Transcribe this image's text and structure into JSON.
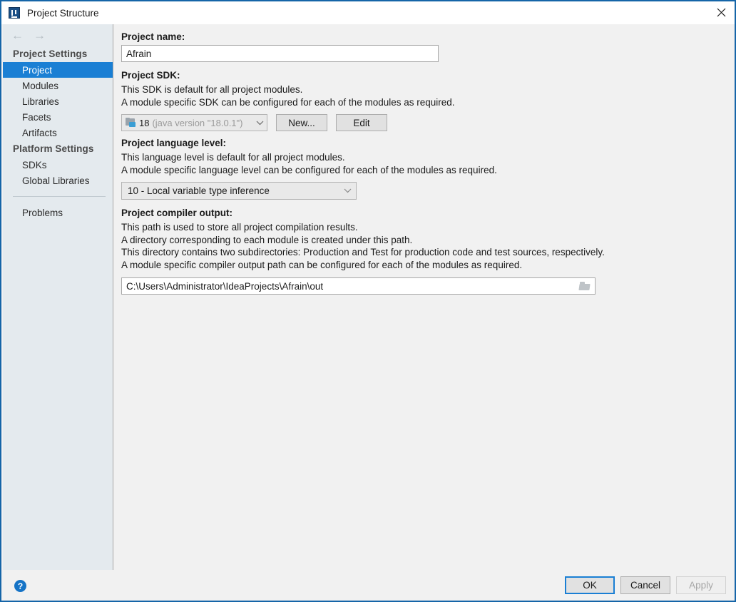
{
  "window": {
    "title": "Project Structure",
    "app_icon": "intellij-idea-icon",
    "close_icon": "close-icon",
    "accent_color": "#1a7fd4",
    "border_color": "#1565a8"
  },
  "sidebar": {
    "back_arrow": "←",
    "forward_arrow": "→",
    "groups": [
      {
        "header": "Project Settings",
        "items": [
          {
            "label": "Project",
            "selected": true
          },
          {
            "label": "Modules",
            "selected": false
          },
          {
            "label": "Libraries",
            "selected": false
          },
          {
            "label": "Facets",
            "selected": false
          },
          {
            "label": "Artifacts",
            "selected": false
          }
        ]
      },
      {
        "header": "Platform Settings",
        "items": [
          {
            "label": "SDKs",
            "selected": false
          },
          {
            "label": "Global Libraries",
            "selected": false
          }
        ]
      }
    ],
    "footer_items": [
      {
        "label": "Problems",
        "selected": false
      }
    ]
  },
  "main": {
    "project_name": {
      "label": "Project name:",
      "value": "Afrain",
      "placeholder": ""
    },
    "project_sdk": {
      "label": "Project SDK:",
      "descriptions": [
        "This SDK is default for all project modules.",
        "A module specific SDK can be configured for each of the modules as required."
      ],
      "selected_name": "18",
      "selected_version": "(java version \"18.0.1\")",
      "icon": "jdk-folder-icon",
      "dropdown_icon": "chevron-down-icon",
      "new_button": "New...",
      "edit_button": "Edit"
    },
    "language_level": {
      "label": "Project language level:",
      "descriptions": [
        "This language level is default for all project modules.",
        "A module specific language level can be configured for each of the modules as required."
      ],
      "selected": "10 - Local variable type inference",
      "dropdown_icon": "chevron-down-icon"
    },
    "compiler_output": {
      "label": "Project compiler output:",
      "descriptions": [
        "This path is used to store all project compilation results.",
        "A directory corresponding to each module is created under this path.",
        "This directory contains two subdirectories: Production and Test for production code and test sources, respectively.",
        "A module specific compiler output path can be configured for each of the modules as required."
      ],
      "value": "C:\\Users\\Administrator\\IdeaProjects\\Afrain\\out",
      "browse_icon": "folder-browse-icon"
    }
  },
  "footer": {
    "help_icon": "help-icon",
    "help_label": "?",
    "buttons": [
      {
        "label": "OK",
        "state": "default-focused"
      },
      {
        "label": "Cancel",
        "state": "normal"
      },
      {
        "label": "Apply",
        "state": "disabled"
      }
    ]
  }
}
